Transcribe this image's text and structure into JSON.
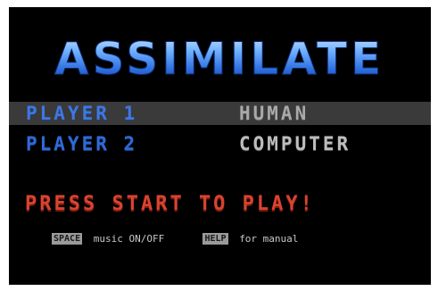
{
  "title": "ASSIMILATE",
  "colors": {
    "background": "#000000",
    "logo_top": "#a9d4ff",
    "logo_bottom": "#1c4fb0",
    "player_label": "#3f78e0",
    "selected_row": "#3a3a3a",
    "controller_label": "#bdbdbd",
    "start_text": "#d9432f"
  },
  "players": [
    {
      "label": "PLAYER 1",
      "controller": "HUMAN",
      "selected": true
    },
    {
      "label": "PLAYER 2",
      "controller": "COMPUTER",
      "selected": false
    }
  ],
  "start_prompt": "PRESS START TO PLAY!",
  "help": {
    "music_key": "SPACE",
    "music_text": "music ON/OFF",
    "manual_key": "HELP",
    "manual_text": "for manual"
  }
}
